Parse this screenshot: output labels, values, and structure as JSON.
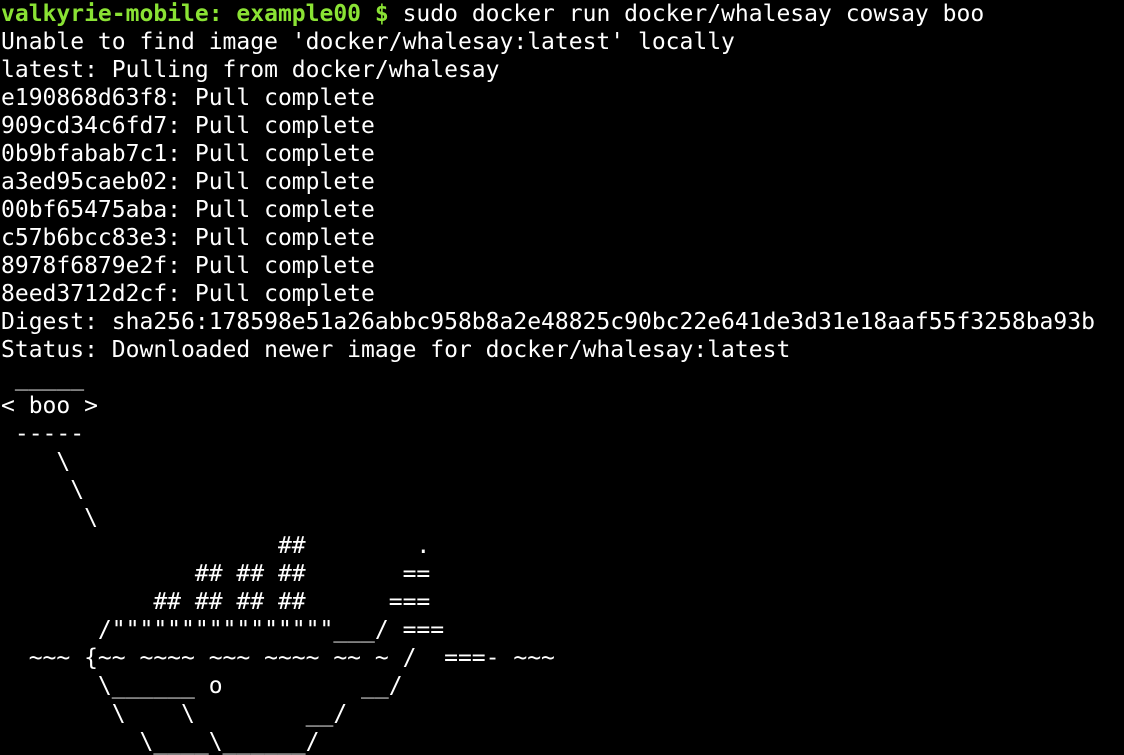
{
  "terminal": {
    "colors": {
      "background": "#000000",
      "foreground": "#ffffff",
      "prompt": "#8ae234"
    },
    "prompt": "valkyrie-mobile: example00 $",
    "command": " sudo docker run docker/whalesay cowsay boo",
    "output": [
      "Unable to find image 'docker/whalesay:latest' locally",
      "latest: Pulling from docker/whalesay",
      "e190868d63f8: Pull complete",
      "909cd34c6fd7: Pull complete",
      "0b9bfabab7c1: Pull complete",
      "a3ed95caeb02: Pull complete",
      "00bf65475aba: Pull complete",
      "c57b6bcc83e3: Pull complete",
      "8978f6879e2f: Pull complete",
      "8eed3712d2cf: Pull complete",
      "Digest: sha256:178598e51a26abbc958b8a2e48825c90bc22e641de3d31e18aaf55f3258ba93b",
      "Status: Downloaded newer image for docker/whalesay:latest",
      " _____",
      "< boo >",
      " -----",
      "    \\",
      "     \\",
      "      \\",
      "                    ##        .",
      "              ## ## ##       ==",
      "           ## ## ## ##      ===",
      "       /\"\"\"\"\"\"\"\"\"\"\"\"\"\"\"\"___/ ===",
      "  ~~~ {~~ ~~~~ ~~~ ~~~~ ~~ ~ /  ===- ~~~",
      "       \\______ o          __/",
      "        \\    \\        __/",
      "          \\____\\______/"
    ]
  }
}
